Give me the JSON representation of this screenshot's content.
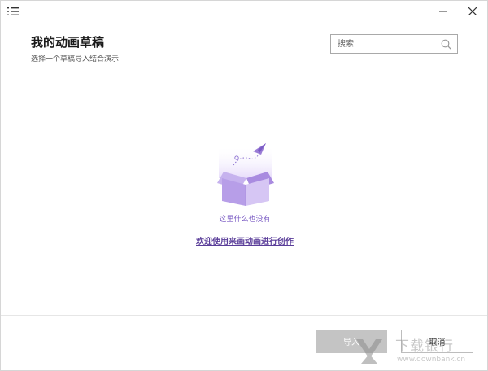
{
  "window": {
    "menu_icon": "list-menu-icon",
    "minimize_icon": "minimize-icon",
    "close_icon": "close-icon"
  },
  "header": {
    "title": "我的动画草稿",
    "subtitle": "选择一个草稿导入结合演示"
  },
  "search": {
    "placeholder": "搜索",
    "value": "",
    "icon": "search-icon"
  },
  "empty_state": {
    "illustration": "empty-box-illustration",
    "message": "这里什么也没有",
    "link": "欢迎使用来画动画进行创作"
  },
  "footer": {
    "import_label": "导入",
    "cancel_label": "取消"
  },
  "watermark": {
    "brand": "下载银行",
    "url": "www.downbank.cn"
  },
  "colors": {
    "accent": "#7b5cc4",
    "link": "#5a3d99",
    "disabled_button": "#c4c4c4",
    "box_light": "#d3c2f0",
    "box_dark": "#9a7cd6"
  }
}
